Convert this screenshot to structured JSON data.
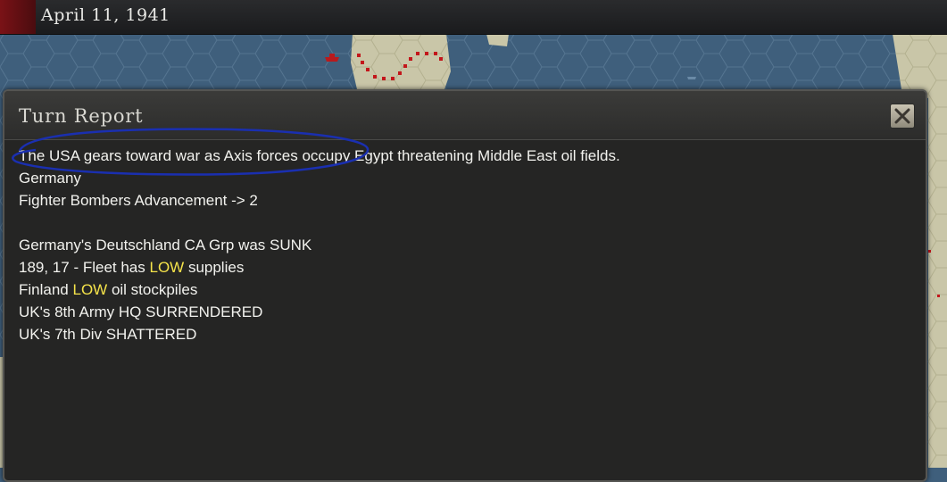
{
  "topbar": {
    "date": "April 11, 1941"
  },
  "report": {
    "title": "Turn Report",
    "close_icon": "close-x-icon",
    "lines": [
      {
        "text": "The USA gears toward war as Axis forces occupy Egypt threatening Middle East oil fields."
      },
      {
        "text": "Germany"
      },
      {
        "text": "Fighter Bombers Advancement -> 2"
      },
      {
        "text": ""
      },
      {
        "text": "Germany's Deutschland CA Grp was SUNK"
      },
      {
        "pre": "189, 17 - Fleet has ",
        "hl": "LOW",
        "post": " supplies"
      },
      {
        "pre": "Finland ",
        "hl": "LOW",
        "post": " oil stockpiles"
      },
      {
        "text": "UK's 8th Army HQ SURRENDERED"
      },
      {
        "text": "UK's 7th Div SHATTERED"
      }
    ]
  },
  "colors": {
    "highlight": "#f5e34a",
    "annotation_circle": "#1a2fb0",
    "sea": "#3f5f7c",
    "land": "#c9c6a8"
  }
}
